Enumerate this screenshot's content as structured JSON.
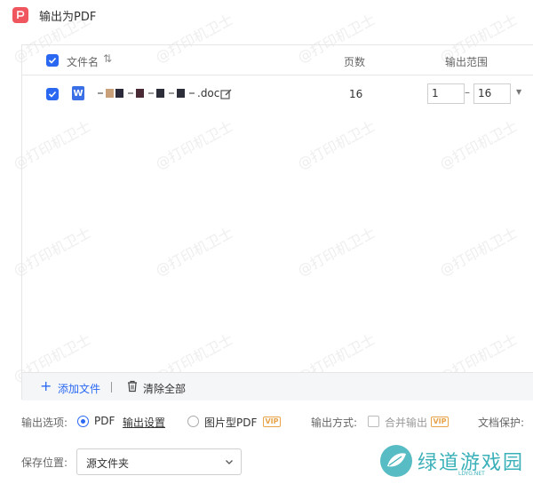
{
  "window": {
    "title": "输出为PDF",
    "app_icon": "pdf-app-icon"
  },
  "table": {
    "headers": {
      "filename": "文件名",
      "pages": "页数",
      "range": "输出范围"
    },
    "rows": [
      {
        "filename": ".doc",
        "pages": "16",
        "range_from": "1",
        "range_to": "16"
      }
    ]
  },
  "footer": {
    "add_label": "添加文件",
    "clear_label": "清除全部"
  },
  "options": {
    "output_label": "输出选项:",
    "pdf_label": "PDF",
    "settings_label": "输出设置",
    "image_pdf_label": "图片型PDF",
    "vip_label": "VIP",
    "mode_label": "输出方式:",
    "merge_label": "合并输出",
    "protect_label": "文档保护:"
  },
  "save": {
    "label": "保存位置:",
    "value": "源文件夹"
  },
  "watermark": "@打印机卫士",
  "brand": {
    "text": "绿道游戏园",
    "sub": "LDYG.NET"
  },
  "colors": {
    "accent": "#2a68f2",
    "vip": "#e8a34a",
    "brand": "#3ab0b8",
    "pdf_icon": "#f0565e"
  }
}
